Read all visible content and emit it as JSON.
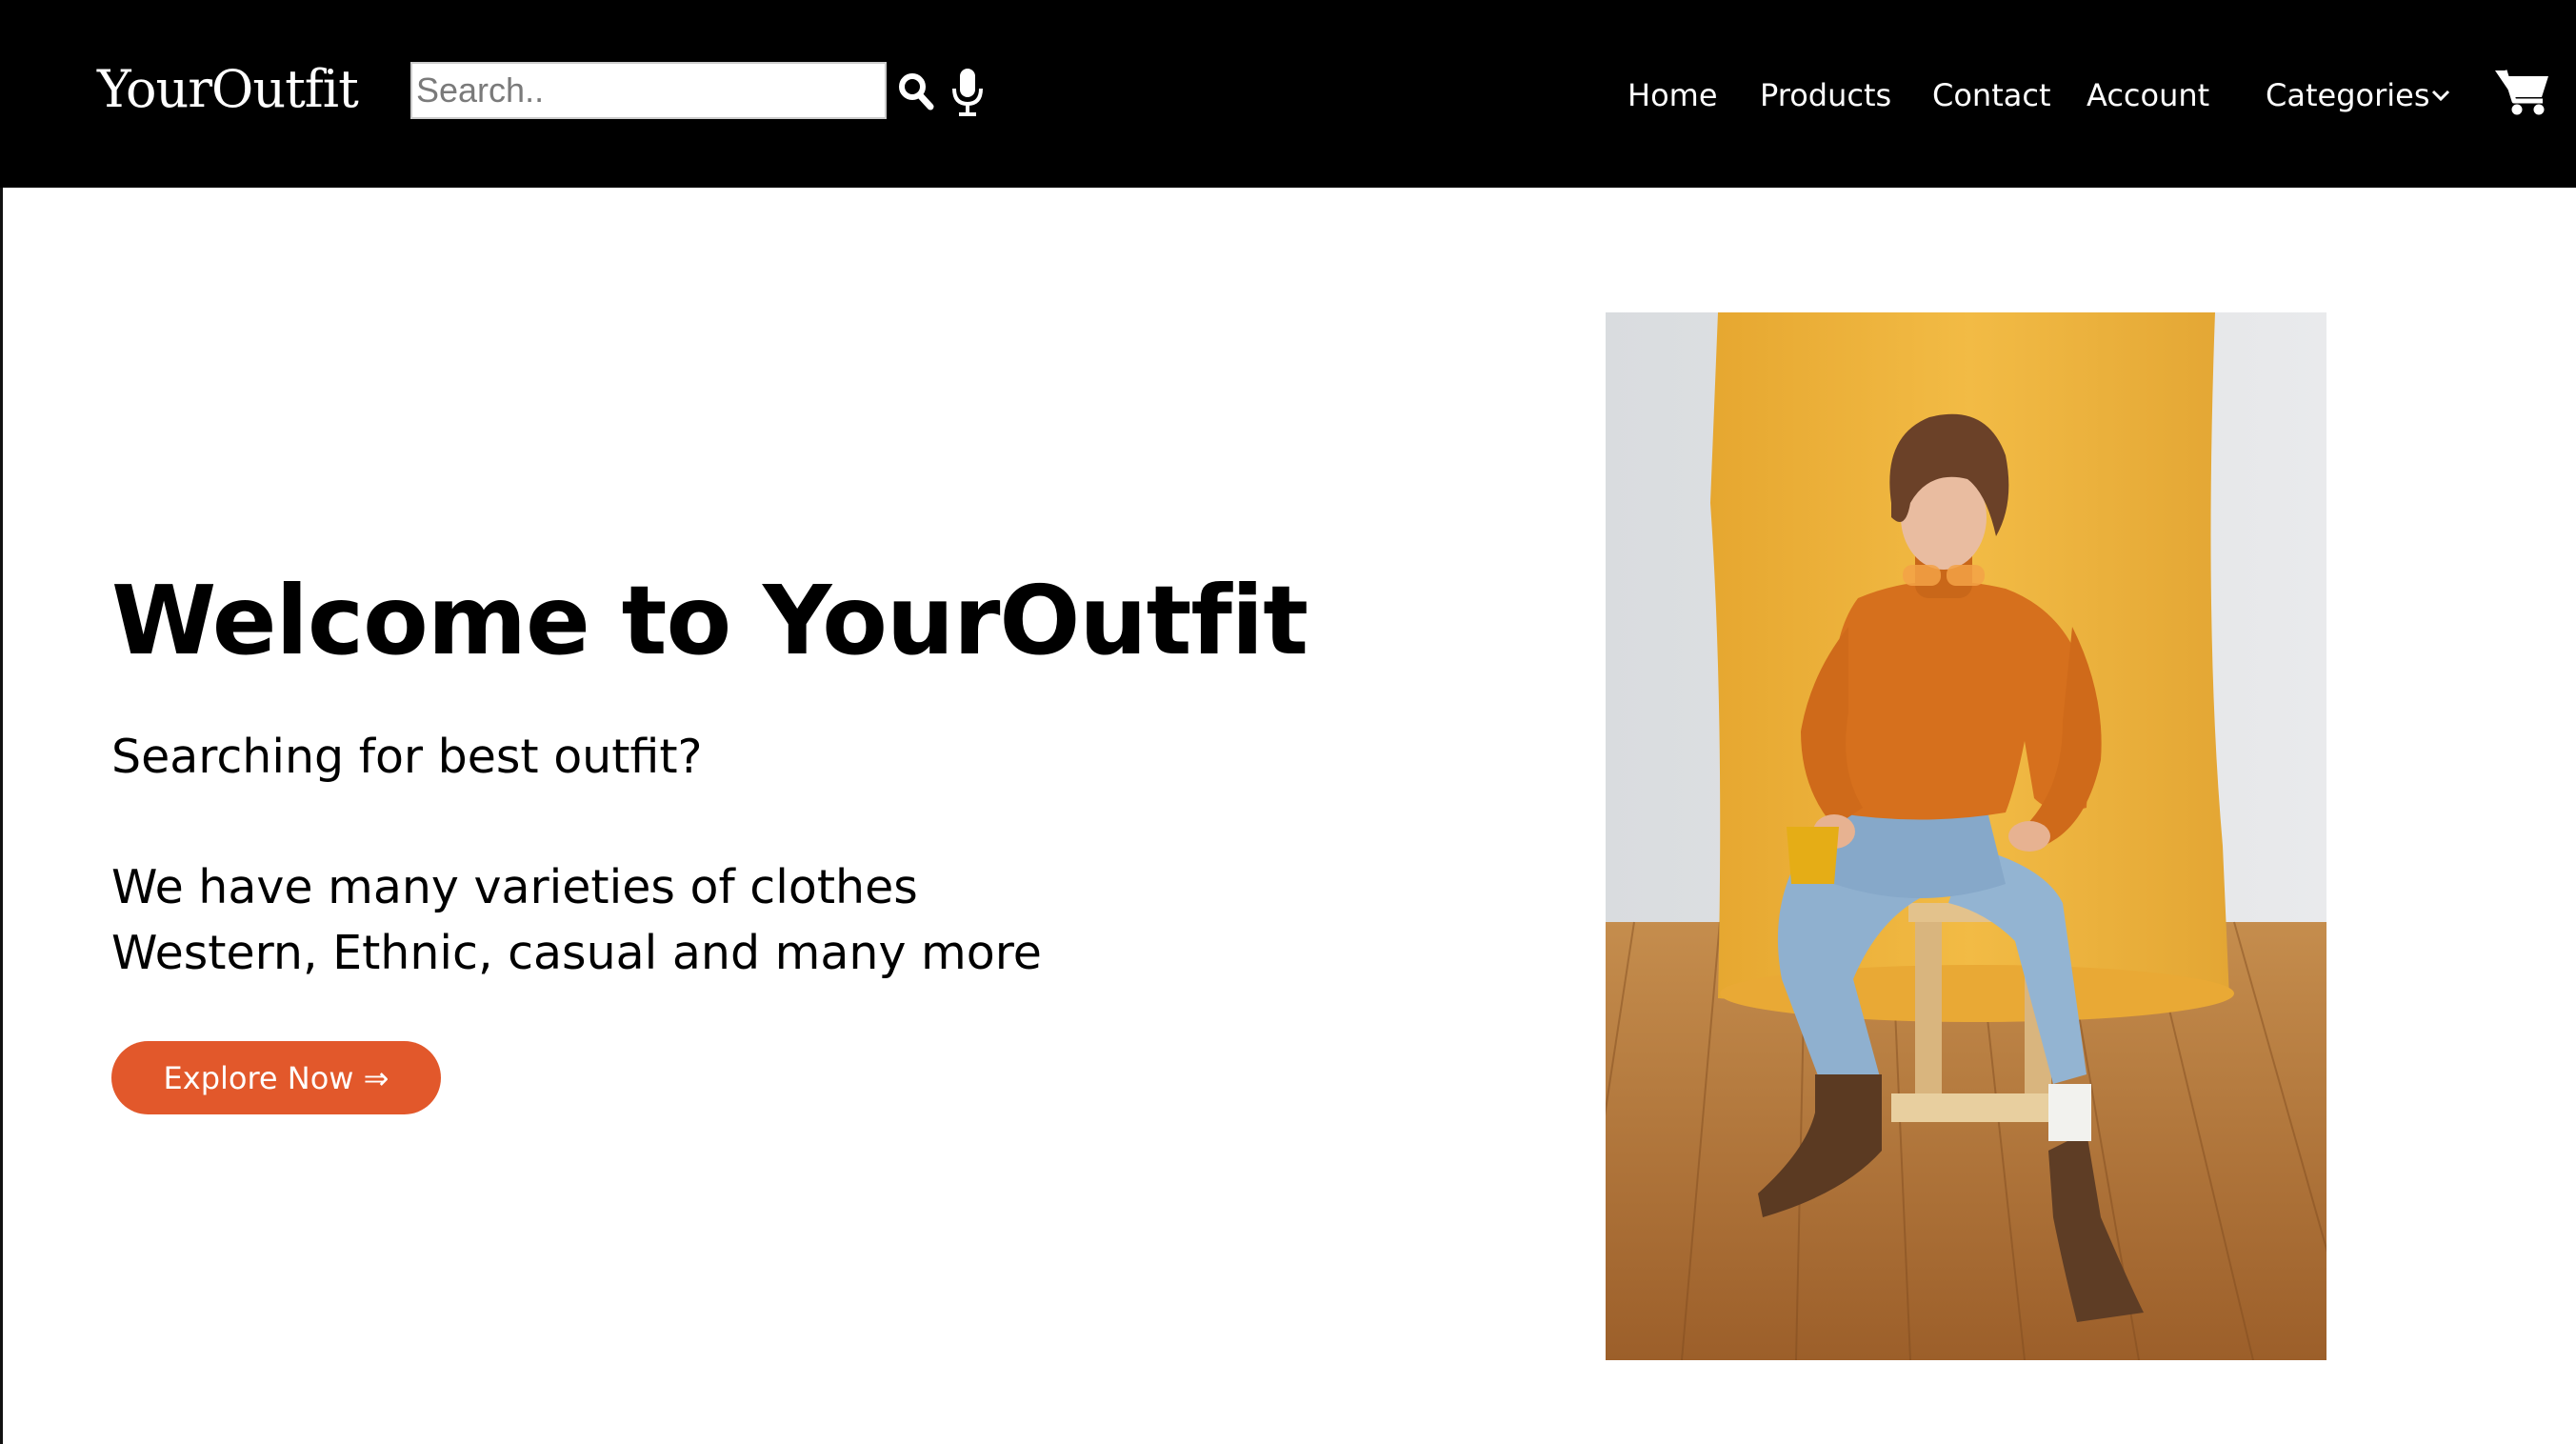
{
  "brand": {
    "name": "YourOutfit"
  },
  "search": {
    "placeholder": "Search..",
    "value": ""
  },
  "nav": {
    "links": [
      "Home",
      "Products",
      "Contact",
      "Account"
    ],
    "categories_label": "Categories"
  },
  "hero": {
    "title": "Welcome to YourOutfit",
    "subtitle": "Searching for best outfit?",
    "description_line1": "We have many varieties of clothes",
    "description_line2": "Western, Ethnic, casual and many more",
    "cta_label": "Explore Now ⇒"
  },
  "icons": [
    "search-icon",
    "microphone-icon",
    "chevron-down-icon",
    "shopping-cart-icon"
  ],
  "colors": {
    "navbar_bg": "#000000",
    "cta_bg": "#e2582b",
    "photo_backdrop": "#f0b63c",
    "photo_sweater": "#d9741f",
    "photo_floor": "#b97a3e"
  }
}
